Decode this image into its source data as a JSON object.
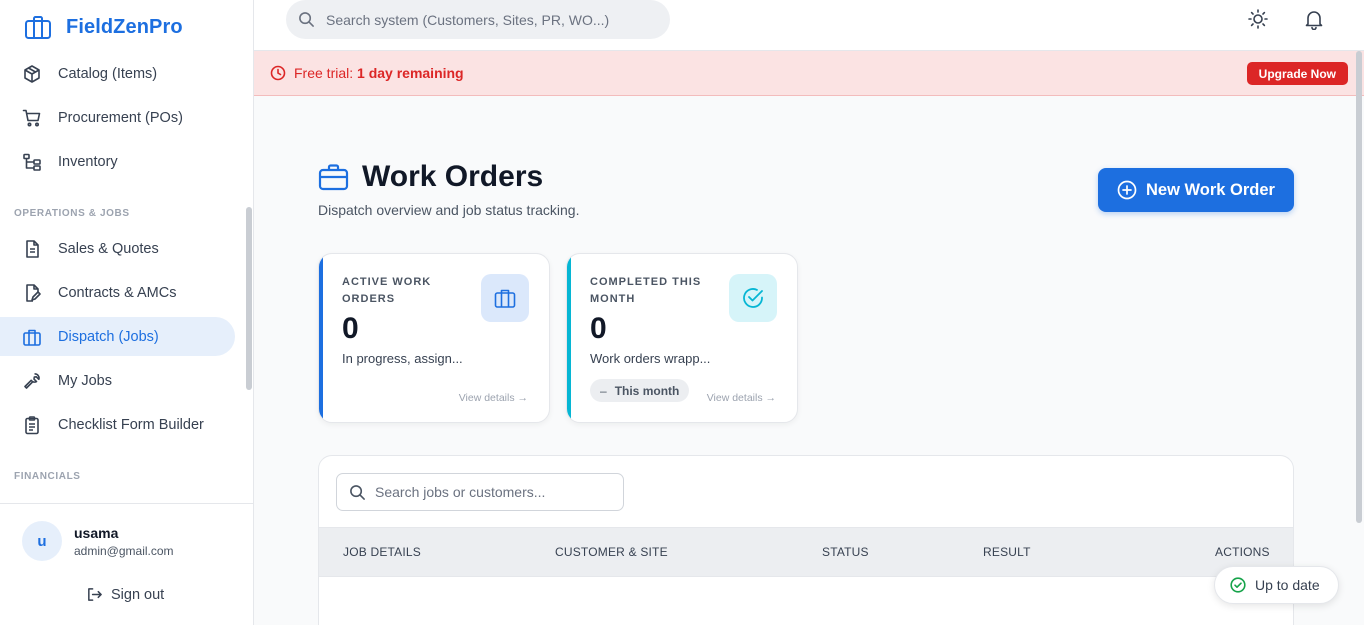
{
  "app": {
    "name": "FieldZenPro"
  },
  "sidebar": {
    "items_top": [
      {
        "label": "Catalog (Items)",
        "icon": "box-icon"
      },
      {
        "label": "Procurement (POs)",
        "icon": "cart-icon"
      },
      {
        "label": "Inventory",
        "icon": "hierarchy-icon"
      }
    ],
    "section_ops": "OPERATIONS & JOBS",
    "items_ops": [
      {
        "label": "Sales & Quotes",
        "icon": "document-icon"
      },
      {
        "label": "Contracts & AMCs",
        "icon": "contract-edit-icon"
      },
      {
        "label": "Dispatch (Jobs)",
        "icon": "briefcase-icon",
        "active": true
      },
      {
        "label": "My Jobs",
        "icon": "wrench-icon"
      },
      {
        "label": "Checklist Form Builder",
        "icon": "clipboard-icon"
      }
    ],
    "section_fin": "FINANCIALS",
    "user": {
      "initial": "u",
      "name": "usama",
      "email": "admin@gmail.com"
    },
    "signout": "Sign out"
  },
  "topbar": {
    "search_placeholder": "Search system (Customers, Sites, PR, WO...)"
  },
  "banner": {
    "prefix": "Free trial:",
    "emphasis": "1 day remaining",
    "button": "Upgrade Now"
  },
  "page": {
    "title": "Work Orders",
    "subtitle": "Dispatch overview and job status tracking.",
    "new_button": "New Work Order"
  },
  "stats": [
    {
      "title": "ACTIVE WORK ORDERS",
      "value": "0",
      "desc": "In progress, assign...",
      "link": "View details →",
      "accent": "#1d6fe0"
    },
    {
      "title": "COMPLETED THIS MONTH",
      "value": "0",
      "desc": "Work orders wrapp...",
      "chip": "This month",
      "chip_prefix": "–",
      "link": "View details →",
      "accent": "#06b6d4"
    }
  ],
  "table": {
    "search_placeholder": "Search jobs or customers...",
    "columns": [
      "JOB DETAILS",
      "CUSTOMER & SITE",
      "STATUS",
      "RESULT",
      "ACTIONS"
    ]
  },
  "toast": {
    "label": "Up to date"
  },
  "colors": {
    "brand": "#1d6fe0",
    "danger": "#dc2626",
    "success": "#16a34a",
    "cyan": "#06b6d4"
  }
}
